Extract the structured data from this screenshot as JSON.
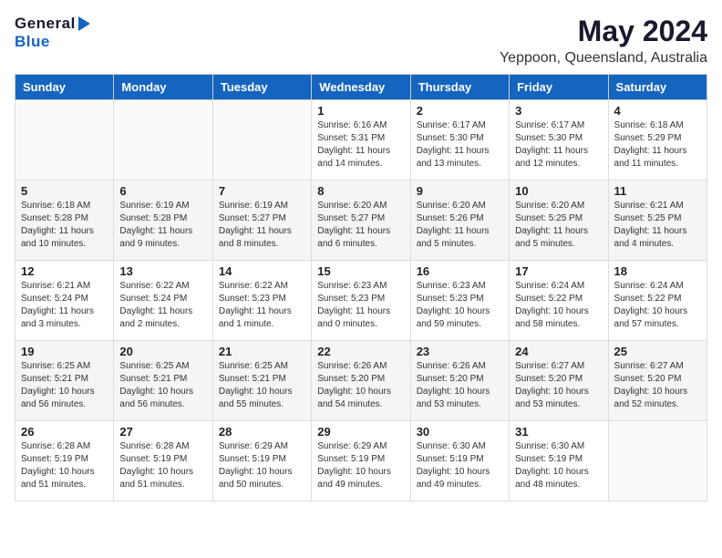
{
  "header": {
    "logo_general": "General",
    "logo_blue": "Blue",
    "month_year": "May 2024",
    "location": "Yeppoon, Queensland, Australia"
  },
  "days_of_week": [
    "Sunday",
    "Monday",
    "Tuesday",
    "Wednesday",
    "Thursday",
    "Friday",
    "Saturday"
  ],
  "weeks": [
    [
      {
        "day": "",
        "info": ""
      },
      {
        "day": "",
        "info": ""
      },
      {
        "day": "",
        "info": ""
      },
      {
        "day": "1",
        "info": "Sunrise: 6:16 AM\nSunset: 5:31 PM\nDaylight: 11 hours\nand 14 minutes."
      },
      {
        "day": "2",
        "info": "Sunrise: 6:17 AM\nSunset: 5:30 PM\nDaylight: 11 hours\nand 13 minutes."
      },
      {
        "day": "3",
        "info": "Sunrise: 6:17 AM\nSunset: 5:30 PM\nDaylight: 11 hours\nand 12 minutes."
      },
      {
        "day": "4",
        "info": "Sunrise: 6:18 AM\nSunset: 5:29 PM\nDaylight: 11 hours\nand 11 minutes."
      }
    ],
    [
      {
        "day": "5",
        "info": "Sunrise: 6:18 AM\nSunset: 5:28 PM\nDaylight: 11 hours\nand 10 minutes."
      },
      {
        "day": "6",
        "info": "Sunrise: 6:19 AM\nSunset: 5:28 PM\nDaylight: 11 hours\nand 9 minutes."
      },
      {
        "day": "7",
        "info": "Sunrise: 6:19 AM\nSunset: 5:27 PM\nDaylight: 11 hours\nand 8 minutes."
      },
      {
        "day": "8",
        "info": "Sunrise: 6:20 AM\nSunset: 5:27 PM\nDaylight: 11 hours\nand 6 minutes."
      },
      {
        "day": "9",
        "info": "Sunrise: 6:20 AM\nSunset: 5:26 PM\nDaylight: 11 hours\nand 5 minutes."
      },
      {
        "day": "10",
        "info": "Sunrise: 6:20 AM\nSunset: 5:25 PM\nDaylight: 11 hours\nand 5 minutes."
      },
      {
        "day": "11",
        "info": "Sunrise: 6:21 AM\nSunset: 5:25 PM\nDaylight: 11 hours\nand 4 minutes."
      }
    ],
    [
      {
        "day": "12",
        "info": "Sunrise: 6:21 AM\nSunset: 5:24 PM\nDaylight: 11 hours\nand 3 minutes."
      },
      {
        "day": "13",
        "info": "Sunrise: 6:22 AM\nSunset: 5:24 PM\nDaylight: 11 hours\nand 2 minutes."
      },
      {
        "day": "14",
        "info": "Sunrise: 6:22 AM\nSunset: 5:23 PM\nDaylight: 11 hours\nand 1 minute."
      },
      {
        "day": "15",
        "info": "Sunrise: 6:23 AM\nSunset: 5:23 PM\nDaylight: 11 hours\nand 0 minutes."
      },
      {
        "day": "16",
        "info": "Sunrise: 6:23 AM\nSunset: 5:23 PM\nDaylight: 10 hours\nand 59 minutes."
      },
      {
        "day": "17",
        "info": "Sunrise: 6:24 AM\nSunset: 5:22 PM\nDaylight: 10 hours\nand 58 minutes."
      },
      {
        "day": "18",
        "info": "Sunrise: 6:24 AM\nSunset: 5:22 PM\nDaylight: 10 hours\nand 57 minutes."
      }
    ],
    [
      {
        "day": "19",
        "info": "Sunrise: 6:25 AM\nSunset: 5:21 PM\nDaylight: 10 hours\nand 56 minutes."
      },
      {
        "day": "20",
        "info": "Sunrise: 6:25 AM\nSunset: 5:21 PM\nDaylight: 10 hours\nand 56 minutes."
      },
      {
        "day": "21",
        "info": "Sunrise: 6:25 AM\nSunset: 5:21 PM\nDaylight: 10 hours\nand 55 minutes."
      },
      {
        "day": "22",
        "info": "Sunrise: 6:26 AM\nSunset: 5:20 PM\nDaylight: 10 hours\nand 54 minutes."
      },
      {
        "day": "23",
        "info": "Sunrise: 6:26 AM\nSunset: 5:20 PM\nDaylight: 10 hours\nand 53 minutes."
      },
      {
        "day": "24",
        "info": "Sunrise: 6:27 AM\nSunset: 5:20 PM\nDaylight: 10 hours\nand 53 minutes."
      },
      {
        "day": "25",
        "info": "Sunrise: 6:27 AM\nSunset: 5:20 PM\nDaylight: 10 hours\nand 52 minutes."
      }
    ],
    [
      {
        "day": "26",
        "info": "Sunrise: 6:28 AM\nSunset: 5:19 PM\nDaylight: 10 hours\nand 51 minutes."
      },
      {
        "day": "27",
        "info": "Sunrise: 6:28 AM\nSunset: 5:19 PM\nDaylight: 10 hours\nand 51 minutes."
      },
      {
        "day": "28",
        "info": "Sunrise: 6:29 AM\nSunset: 5:19 PM\nDaylight: 10 hours\nand 50 minutes."
      },
      {
        "day": "29",
        "info": "Sunrise: 6:29 AM\nSunset: 5:19 PM\nDaylight: 10 hours\nand 49 minutes."
      },
      {
        "day": "30",
        "info": "Sunrise: 6:30 AM\nSunset: 5:19 PM\nDaylight: 10 hours\nand 49 minutes."
      },
      {
        "day": "31",
        "info": "Sunrise: 6:30 AM\nSunset: 5:19 PM\nDaylight: 10 hours\nand 48 minutes."
      },
      {
        "day": "",
        "info": ""
      }
    ]
  ]
}
